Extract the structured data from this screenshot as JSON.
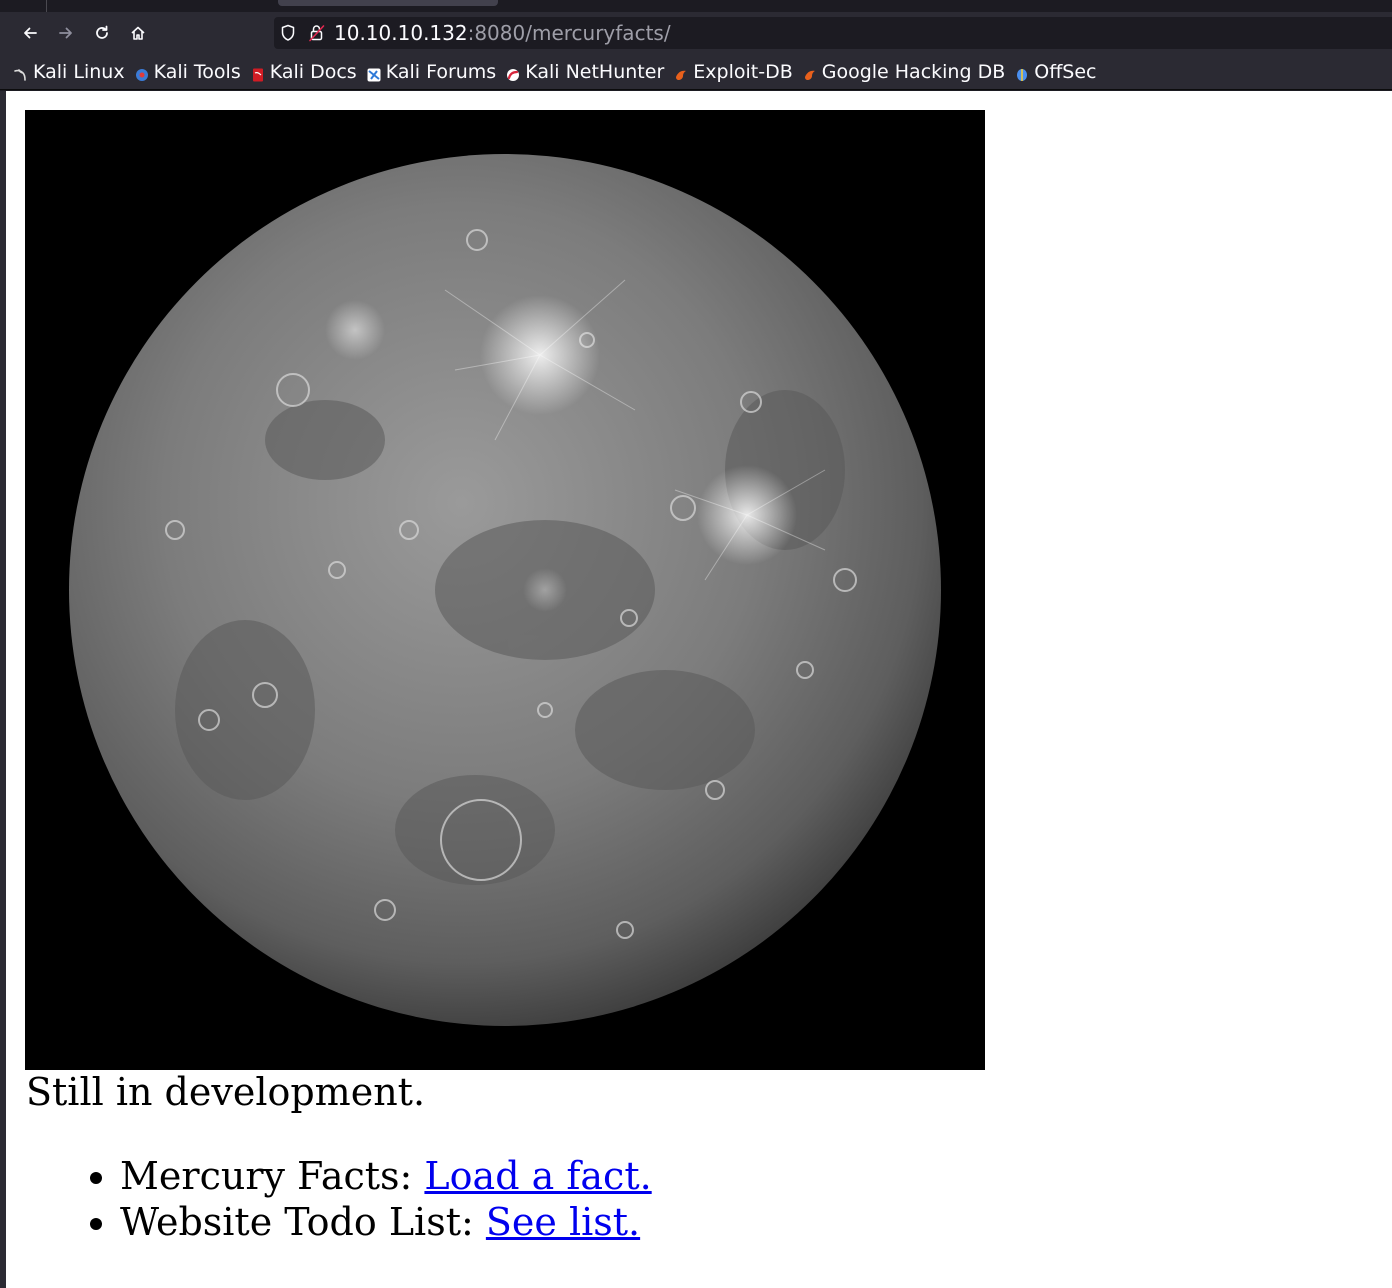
{
  "browser": {
    "url_host": "10.10.10.132",
    "url_rest": ":8080/mercuryfacts/",
    "nav": {
      "back": "back-icon",
      "forward": "forward-icon",
      "reload": "reload-icon",
      "home": "home-icon"
    }
  },
  "bookmarks": [
    {
      "label": "Kali Linux",
      "icon": "kali-linux-icon",
      "color": "#dcdcdc"
    },
    {
      "label": "Kali Tools",
      "icon": "kali-tools-icon",
      "color": "#3b7bd6"
    },
    {
      "label": "Kali Docs",
      "icon": "kali-docs-icon",
      "color": "#d01c24"
    },
    {
      "label": "Kali Forums",
      "icon": "kali-forums-icon",
      "color": "#2f7ad8"
    },
    {
      "label": "Kali NetHunter",
      "icon": "kali-nethunter-icon",
      "color": "#d7263d"
    },
    {
      "label": "Exploit-DB",
      "icon": "exploit-db-icon",
      "color": "#e8601c"
    },
    {
      "label": "Google Hacking DB",
      "icon": "google-hacking-db-icon",
      "color": "#e8601c"
    },
    {
      "label": "OffSec",
      "icon": "offsec-icon",
      "color": "#4a8ff0"
    }
  ],
  "page": {
    "status_text": "Still in development.",
    "items": [
      {
        "prefix": "Mercury Facts: ",
        "link_text": "Load a fact."
      },
      {
        "prefix": "Website Todo List: ",
        "link_text": "See list."
      }
    ]
  }
}
